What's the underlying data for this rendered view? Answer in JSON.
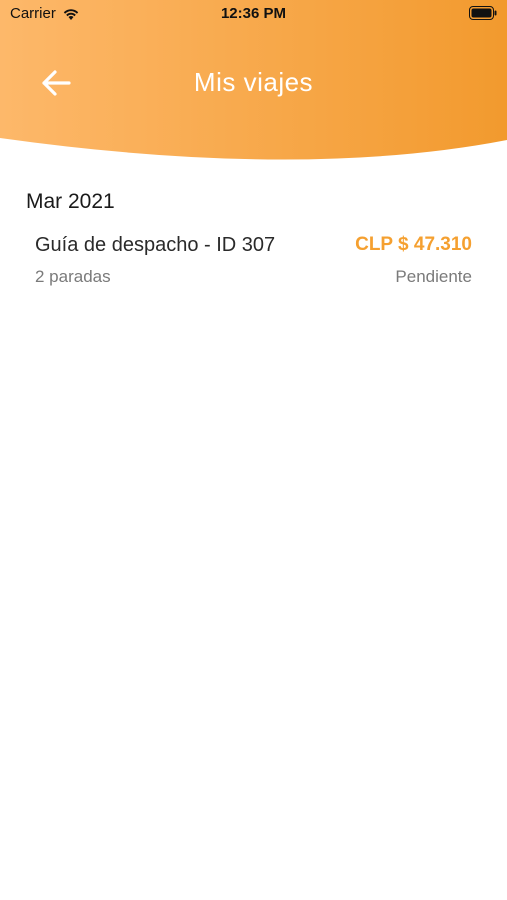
{
  "status_bar": {
    "carrier": "Carrier",
    "time": "12:36 PM"
  },
  "header": {
    "title": "Mis viajes",
    "back_icon": "arrow-left-icon",
    "gradient_colors": [
      "#fdb86a",
      "#f29a2e"
    ]
  },
  "trips": {
    "section_title": "Mar 2021",
    "items": [
      {
        "title": "Guía de despacho - ID 307",
        "amount": "CLP $ 47.310",
        "stops": "2 paradas",
        "status": "Pendiente"
      }
    ]
  },
  "colors": {
    "accent": "#f5a030",
    "secondary_text": "#7a7a7a"
  }
}
